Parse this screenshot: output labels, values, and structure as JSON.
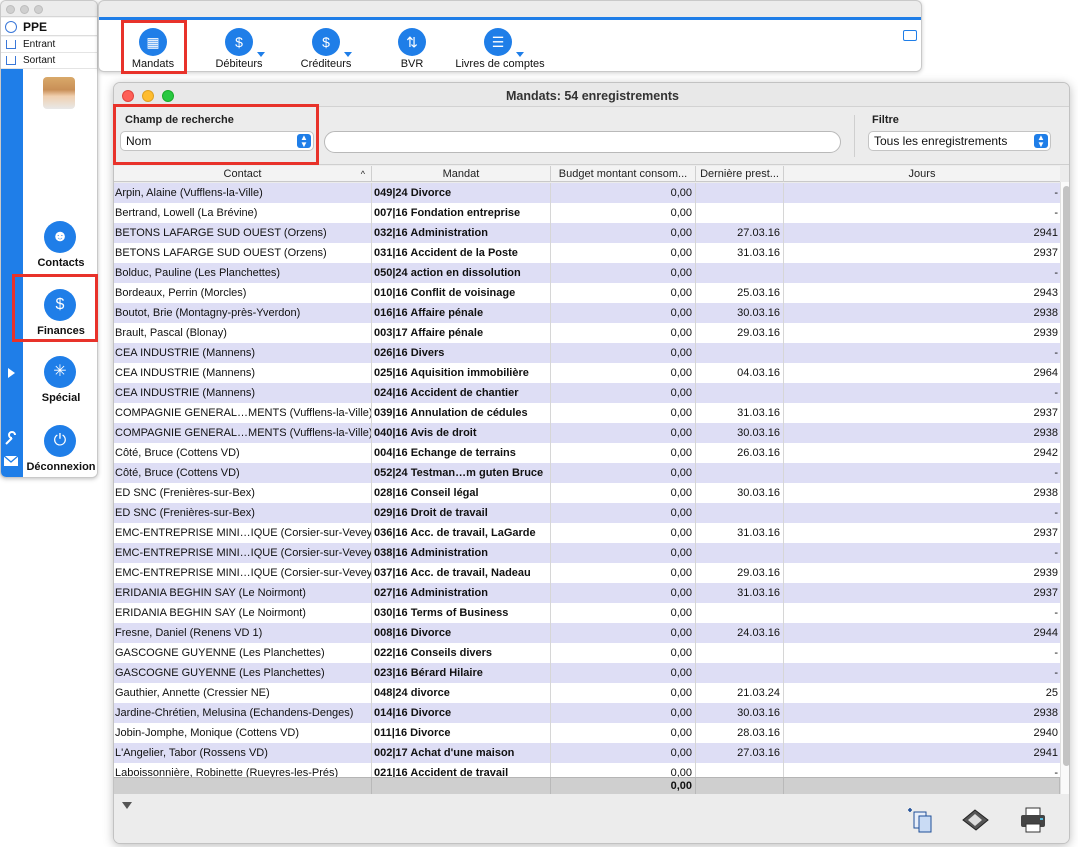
{
  "palette": {
    "title": "PPE",
    "entrant": "Entrant",
    "sortant": "Sortant",
    "nav": [
      {
        "label": "Contacts",
        "icon": "contacts-icon"
      },
      {
        "label": "Finances",
        "icon": "finances-icon"
      },
      {
        "label": "Spécial",
        "icon": "wheel-icon"
      },
      {
        "label": "Déconnexion",
        "icon": "power-icon"
      }
    ]
  },
  "toolbar": {
    "items": [
      {
        "label": "Mandats",
        "icon": "folder-icon"
      },
      {
        "label": "Débiteurs",
        "icon": "hand-money-icon"
      },
      {
        "label": "Créditeurs",
        "icon": "hand-money-icon"
      },
      {
        "label": "BVR",
        "icon": "arrows-icon"
      },
      {
        "label": "Livres de comptes",
        "icon": "ledger-icon"
      }
    ]
  },
  "window": {
    "title": "Mandats: 54 enregistrements",
    "search_field_label": "Champ de recherche",
    "search_field_value": "Nom",
    "search_value": "",
    "filter_label": "Filtre",
    "filter_value": "Tous les enregistrements"
  },
  "table": {
    "headers": [
      "Contact",
      "Mandat",
      "Budget montant consom...",
      "Dernière prest...",
      "Jours"
    ],
    "sort_indicator": "^",
    "rows": [
      [
        "Arpin, Alaine (Vufflens-la-Ville)",
        "049|24 Divorce",
        "0,00",
        "",
        "-"
      ],
      [
        "Bertrand, Lowell (La Brévine)",
        "007|16 Fondation entreprise",
        "0,00",
        "",
        "-"
      ],
      [
        "BETONS LAFARGE SUD OUEST (Orzens)",
        "032|16 Administration",
        "0,00",
        "27.03.16",
        "2941"
      ],
      [
        "BETONS LAFARGE SUD OUEST (Orzens)",
        "031|16 Accident de la Poste",
        "0,00",
        "31.03.16",
        "2937"
      ],
      [
        "Bolduc, Pauline (Les Planchettes)",
        "050|24 action en dissolution",
        "0,00",
        "",
        "-"
      ],
      [
        "Bordeaux, Perrin (Morcles)",
        "010|16 Conflit de voisinage",
        "0,00",
        "25.03.16",
        "2943"
      ],
      [
        "Boutot, Brie (Montagny-près-Yverdon)",
        "016|16 Affaire pénale",
        "0,00",
        "30.03.16",
        "2938"
      ],
      [
        "Brault, Pascal (Blonay)",
        "003|17 Affaire pénale",
        "0,00",
        "29.03.16",
        "2939"
      ],
      [
        "CEA INDUSTRIE (Mannens)",
        "026|16 Divers",
        "0,00",
        "",
        "-"
      ],
      [
        "CEA INDUSTRIE (Mannens)",
        "025|16 Aquisition immobilière",
        "0,00",
        "04.03.16",
        "2964"
      ],
      [
        "CEA INDUSTRIE (Mannens)",
        "024|16 Accident de chantier",
        "0,00",
        "",
        "-"
      ],
      [
        "COMPAGNIE GENERAL…MENTS (Vufflens-la-Ville)",
        "039|16 Annulation de cédules",
        "0,00",
        "31.03.16",
        "2937"
      ],
      [
        "COMPAGNIE GENERAL…MENTS (Vufflens-la-Ville)",
        "040|16 Avis de droit",
        "0,00",
        "30.03.16",
        "2938"
      ],
      [
        "Côté, Bruce (Cottens VD)",
        "004|16 Echange de terrains",
        "0,00",
        "26.03.16",
        "2942"
      ],
      [
        "Côté, Bruce (Cottens VD)",
        "052|24 Testman…m guten Bruce",
        "0,00",
        "",
        "-"
      ],
      [
        "ED SNC (Frenières-sur-Bex)",
        "028|16 Conseil légal",
        "0,00",
        "30.03.16",
        "2938"
      ],
      [
        "ED SNC (Frenières-sur-Bex)",
        "029|16 Droit de travail",
        "0,00",
        "",
        "-"
      ],
      [
        "EMC-ENTREPRISE MINI…IQUE (Corsier-sur-Vevey)",
        "036|16 Acc. de travail, LaGarde",
        "0,00",
        "31.03.16",
        "2937"
      ],
      [
        "EMC-ENTREPRISE MINI…IQUE (Corsier-sur-Vevey)",
        "038|16 Administration",
        "0,00",
        "",
        "-"
      ],
      [
        "EMC-ENTREPRISE MINI…IQUE (Corsier-sur-Vevey)",
        "037|16 Acc. de travail, Nadeau",
        "0,00",
        "29.03.16",
        "2939"
      ],
      [
        "ERIDANIA BEGHIN SAY (Le Noirmont)",
        "027|16 Administration",
        "0,00",
        "31.03.16",
        "2937"
      ],
      [
        "ERIDANIA BEGHIN SAY (Le Noirmont)",
        "030|16 Terms of Business",
        "0,00",
        "",
        "-"
      ],
      [
        "Fresne, Daniel (Renens VD 1)",
        "008|16 Divorce",
        "0,00",
        "24.03.16",
        "2944"
      ],
      [
        "GASCOGNE GUYENNE (Les Planchettes)",
        "022|16 Conseils divers",
        "0,00",
        "",
        "-"
      ],
      [
        "GASCOGNE GUYENNE (Les Planchettes)",
        "023|16 Bérard Hilaire",
        "0,00",
        "",
        "-"
      ],
      [
        "Gauthier, Annette (Cressier NE)",
        "048|24 divorce",
        "0,00",
        "21.03.24",
        "25"
      ],
      [
        "Jardine-Chrétien, Melusina (Echandens-Denges)",
        "014|16 Divorce",
        "0,00",
        "30.03.16",
        "2938"
      ],
      [
        "Jobin-Jomphe, Monique (Cottens VD)",
        "011|16 Divorce",
        "0,00",
        "28.03.16",
        "2940"
      ],
      [
        "L'Angelier, Tabor (Rossens VD)",
        "002|17 Achat d'une maison",
        "0,00",
        "27.03.16",
        "2941"
      ],
      [
        "Laboissonnière, Robinette (Rueyres-les-Prés)",
        "021|16 Accident de travail",
        "0,00",
        "",
        "-"
      ]
    ],
    "total": "0,00"
  },
  "bottom_icons": [
    "new-document-icon",
    "calculator-icon",
    "print-icon"
  ]
}
